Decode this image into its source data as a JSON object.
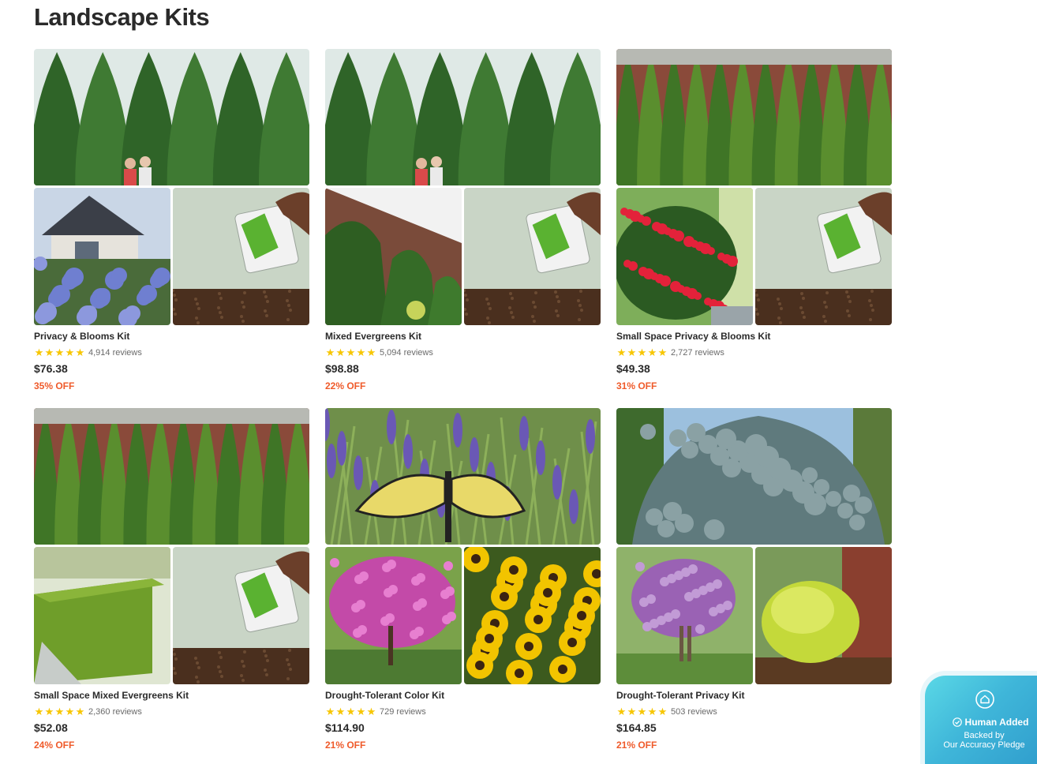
{
  "section_title": "Landscape Kits",
  "kits": [
    {
      "name": "Privacy & Blooms Kit",
      "reviews": "4,914 reviews",
      "price": "$76.38",
      "discount": "35% OFF",
      "rating_stars": 5,
      "images": [
        "arborvitae-hedge-with-couple",
        "blue-hydrangea-by-house",
        "fertilizer-pouch-over-soil"
      ]
    },
    {
      "name": "Mixed Evergreens Kit",
      "reviews": "5,094 reviews",
      "price": "$98.88",
      "discount": "22% OFF",
      "rating_stars": 5,
      "images": [
        "arborvitae-hedge-with-couple",
        "green-holly-shrubs-by-wall",
        "fertilizer-pouch-over-soil"
      ]
    },
    {
      "name": "Small Space Privacy & Blooms Kit",
      "reviews": "2,727 reviews",
      "price": "$49.38",
      "discount": "31% OFF",
      "rating_stars": 5,
      "images": [
        "narrow-arborvitae-row",
        "red-rose-bush",
        "fertilizer-pouch-over-soil"
      ]
    },
    {
      "name": "Small Space Mixed Evergreens Kit",
      "reviews": "2,360 reviews",
      "price": "$52.08",
      "discount": "24% OFF",
      "rating_stars": 5,
      "images": [
        "narrow-arborvitae-row",
        "boxwood-hedge-by-path",
        "fertilizer-pouch-over-soil"
      ]
    },
    {
      "name": "Drought-Tolerant Color Kit",
      "reviews": "729 reviews",
      "price": "$114.90",
      "discount": "21% OFF",
      "rating_stars": 5,
      "images": [
        "butterfly-on-lavender",
        "pink-redbud-tree",
        "yellow-black-eyed-susans"
      ]
    },
    {
      "name": "Drought-Tolerant Privacy Kit",
      "reviews": "503 reviews",
      "price": "$164.85",
      "discount": "21% OFF",
      "rating_stars": 5,
      "images": [
        "blue-spruce-evergreen",
        "purple-crape-myrtle",
        "yellow-cypress-shrub"
      ]
    }
  ],
  "badge": {
    "title": "Human Added",
    "line1": "Backed by",
    "line2": "Our Accuracy Pledge",
    "icon": "home-shield-icon"
  },
  "colors": {
    "discount": "#ef5a2a",
    "star": "#f7c600",
    "badge_gradient_start": "#5ad8e6",
    "badge_gradient_end": "#2f9ccc"
  }
}
